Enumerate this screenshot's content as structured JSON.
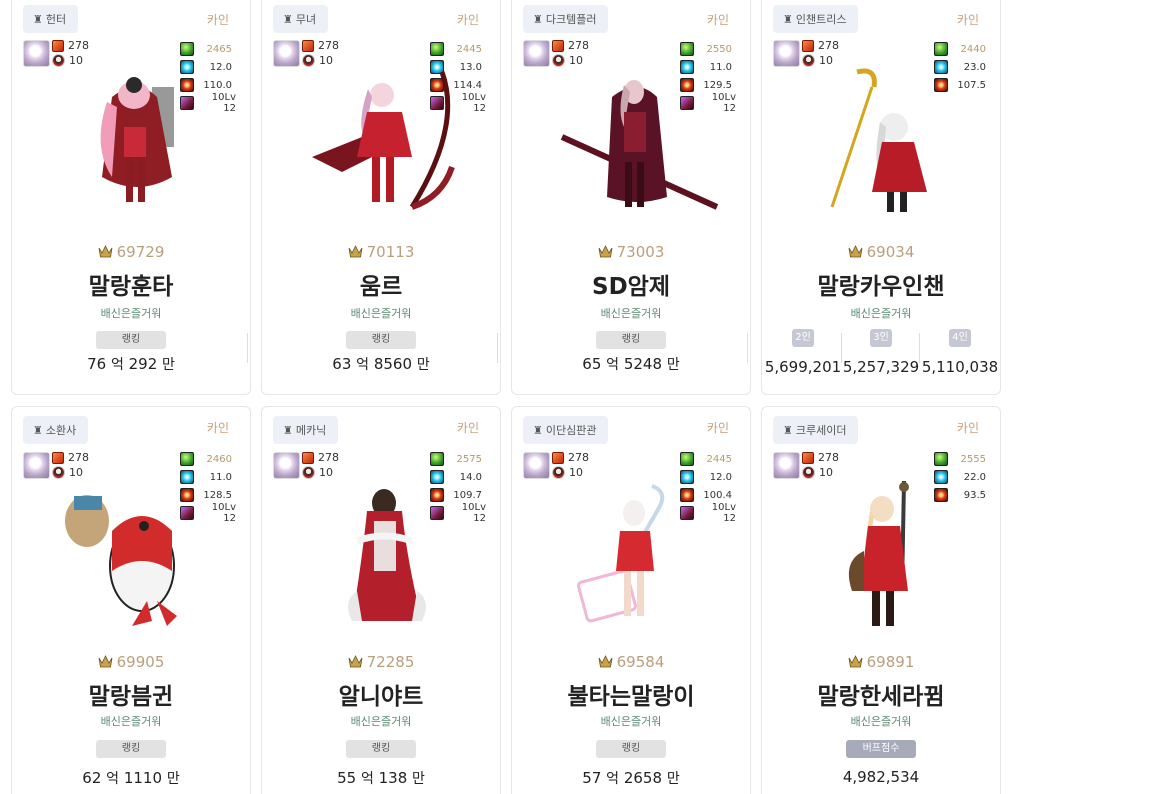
{
  "server_label": "카인",
  "adventure_name": "배신은즐거워",
  "rank_label": "랭킹",
  "buff_label": "버프점수",
  "value_unit_1": "억",
  "value_unit_2": "만",
  "cards": [
    {
      "job": "헌터",
      "gear": "278",
      "lv": "10",
      "stats": [
        "2465",
        "12.0",
        "110.0",
        "10Lv 12"
      ],
      "score": "69729",
      "name": "말랑훈타",
      "value_a": "76",
      "value_b": "292"
    },
    {
      "job": "무녀",
      "gear": "278",
      "lv": "10",
      "stats": [
        "2445",
        "13.0",
        "114.4",
        "10Lv 12"
      ],
      "score": "70113",
      "name": "움르",
      "value_a": "63",
      "value_b": "8560"
    },
    {
      "job": "다크템플러",
      "gear": "278",
      "lv": "10",
      "stats": [
        "2550",
        "11.0",
        "129.5",
        "10Lv 12"
      ],
      "score": "73003",
      "name": "SD암제",
      "value_a": "65",
      "value_b": "5248"
    },
    {
      "job": "인챈트리스",
      "gear": "278",
      "lv": "10",
      "stats": [
        "2440",
        "23.0",
        "107.5"
      ],
      "score": "69034",
      "name": "말랑카우인챈",
      "party": [
        {
          "label": "2인",
          "value": "5,699,201"
        },
        {
          "label": "3인",
          "value": "5,257,329"
        },
        {
          "label": "4인",
          "value": "5,110,038"
        }
      ]
    },
    {
      "job": "소환사",
      "gear": "278",
      "lv": "10",
      "stats": [
        "2460",
        "11.0",
        "128.5",
        "10Lv 12"
      ],
      "score": "69905",
      "name": "말랑븜귄",
      "value_a": "62",
      "value_b": "1110"
    },
    {
      "job": "메카닉",
      "gear": "278",
      "lv": "10",
      "stats": [
        "2575",
        "14.0",
        "109.7",
        "10Lv 12"
      ],
      "score": "72285",
      "name": "알니야트",
      "value_a": "55",
      "value_b": "138"
    },
    {
      "job": "이단심판관",
      "gear": "278",
      "lv": "10",
      "stats": [
        "2445",
        "12.0",
        "100.4",
        "10Lv 12"
      ],
      "score": "69584",
      "name": "불타는말랑이",
      "value_a": "57",
      "value_b": "2658"
    },
    {
      "job": "크루세이더",
      "gear": "278",
      "lv": "10",
      "stats": [
        "2555",
        "22.0",
        "93.5"
      ],
      "score": "69891",
      "name": "말랑한세라뀜",
      "buff_value": "4,982,534"
    }
  ]
}
